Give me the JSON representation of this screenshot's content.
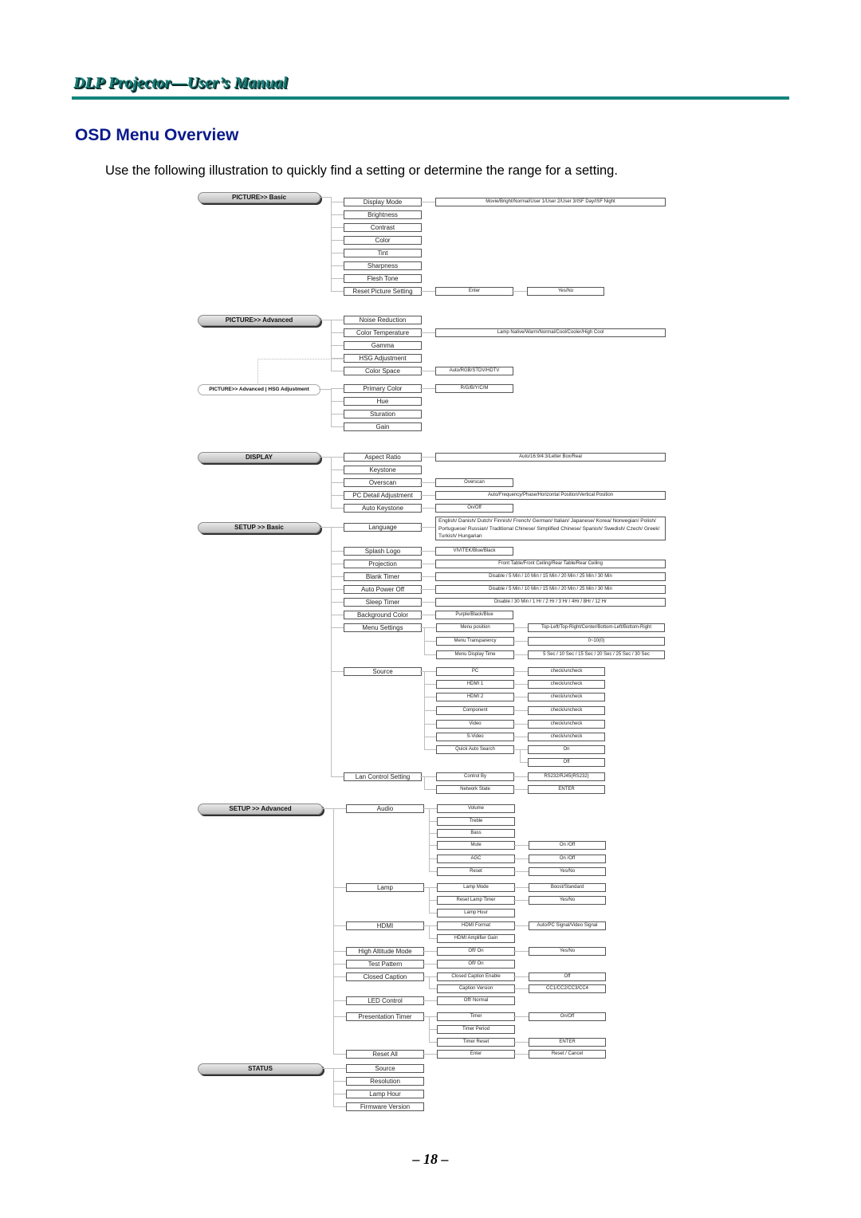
{
  "header": {
    "title": "DLP Projector—User’s Manual"
  },
  "page_title": "OSD Menu Overview",
  "intro": "Use the following illustration to quickly find a setting or determine the range for a setting.",
  "page_number": "– 18 –",
  "sections": [
    {
      "label": "PICTURE>> Basic",
      "items": [
        {
          "label": "Display Mode",
          "options": [
            "Movie/Bright/Normal/User 1/User 2/User 3/ISF Day/ISF Night"
          ]
        },
        {
          "label": "Brightness"
        },
        {
          "label": "Contrast"
        },
        {
          "label": "Color"
        },
        {
          "label": "Tint"
        },
        {
          "label": "Sharpness"
        },
        {
          "label": "Flesh Tone"
        },
        {
          "label": "Reset Picture Setting",
          "options": [
            "Enter",
            "Yes/No"
          ]
        }
      ]
    },
    {
      "label": "PICTURE>> Advanced",
      "items": [
        {
          "label": "Noise Reduction"
        },
        {
          "label": "Color Temperature",
          "options": [
            "Lamp Native/Warm/Normal/Cool/Cooler/High Cool"
          ]
        },
        {
          "label": "Gamma"
        },
        {
          "label": "HSG Adjustment"
        },
        {
          "label": "Color Space",
          "options": [
            "Auto/RGB/STDV/HDTV"
          ]
        }
      ]
    },
    {
      "label": "PICTURE>> Advanced | HSG Adjustment",
      "items": [
        {
          "label": "Primary Color",
          "options": [
            "R/G/B/Y/C/M"
          ]
        },
        {
          "label": "Hue"
        },
        {
          "label": "Sturation"
        },
        {
          "label": "Gain"
        }
      ]
    },
    {
      "label": "DISPLAY",
      "items": [
        {
          "label": "Aspect Ratio",
          "options": [
            "Auto/16:9/4:3/Letter Box/Real"
          ]
        },
        {
          "label": "Keystone"
        },
        {
          "label": "Overscan",
          "options": [
            "Overscan"
          ]
        },
        {
          "label": "PC Detail Adjustment",
          "options": [
            "Auto/Frequency/Phase/Horizontal Position/Vertical Position"
          ]
        },
        {
          "label": "Auto Keystone",
          "options": [
            "On/Off"
          ]
        }
      ]
    },
    {
      "label": "SETUP >> Basic",
      "items": [
        {
          "label": "Language",
          "options": [
            "English/ Danish/ Dutch/ Finnish/ French/ German/ Italian/ Japanese/ Korea/ Norwegian/ Polish/ Portuguese/ Russian/ Traditional Chinese/ Simplified Chinese/ Spanish/ Swedish/ Czech/ Greek/ Turkish/ Hungarian"
          ]
        },
        {
          "label": "Splash Logo",
          "options": [
            "VIVITEK/Blue/Black"
          ]
        },
        {
          "label": "Projection",
          "options": [
            "Front Table/Front Ceiling/Rear Table/Rear Ceiling"
          ]
        },
        {
          "label": "Blank Timer",
          "options": [
            "Disable / 5 Min / 10 Min / 15 Min / 20 Min / 25 Min / 30 Min"
          ]
        },
        {
          "label": "Auto Power Off",
          "options": [
            "Disable / 5 Min / 10 Min / 15 Min / 20 Min / 25 Min / 30 Min"
          ]
        },
        {
          "label": "Sleep Timer",
          "options": [
            "Disable / 30 Min / 1 Hr / 2 Hr / 3 Hr / 4Hr / 8Hr / 12 Hr"
          ]
        },
        {
          "label": "Background Color",
          "options": [
            "Purple/Black/Blue"
          ]
        },
        {
          "label": "Menu Settings",
          "children": [
            {
              "label": "Menu position",
              "value": "Top-Left/Top-Right/Center/Bottom-Left/Bottom-Right"
            },
            {
              "label": "Menu Transparency",
              "value": "0~10(0)"
            },
            {
              "label": "Menu Display Time",
              "value": "5 Sec / 10 Sec / 15 Sec / 20 Sec / 25 Sec / 30 Sec"
            }
          ]
        },
        {
          "label": "Source",
          "children": [
            {
              "label": "PC",
              "value": "check/uncheck"
            },
            {
              "label": "HDMI 1",
              "value": "check/uncheck"
            },
            {
              "label": "HDMI 2",
              "value": "check/uncheck"
            },
            {
              "label": "Component",
              "value": "check/uncheck"
            },
            {
              "label": "Video",
              "value": "check/uncheck"
            },
            {
              "label": "S-Video",
              "value": "check/uncheck"
            },
            {
              "label": "Quick Auto Search",
              "values": [
                "On",
                "Off"
              ]
            }
          ]
        },
        {
          "label": "Lan Control Setting",
          "children": [
            {
              "label": "Control By",
              "value": "RS232/RJ45(RS232)"
            },
            {
              "label": "Network State",
              "value": "ENTER"
            }
          ]
        }
      ]
    },
    {
      "label": "SETUP >> Advanced",
      "items": [
        {
          "label": "Audio",
          "children": [
            {
              "label": "Volume"
            },
            {
              "label": "Treble"
            },
            {
              "label": "Bass"
            },
            {
              "label": "Mute",
              "value": "On /Off"
            },
            {
              "label": "AGC",
              "value": "On /Off"
            },
            {
              "label": "Reset",
              "value": "Yes/No"
            }
          ]
        },
        {
          "label": "Lamp",
          "children": [
            {
              "label": "Lamp Mode",
              "value": "Boost/Standard"
            },
            {
              "label": "Reset Lamp Timer",
              "value": "Yes/No"
            },
            {
              "label": "Lamp Hour"
            }
          ]
        },
        {
          "label": "HDMI",
          "children": [
            {
              "label": "HDMI Format",
              "value": "Auto/PC Signal/Video Signal"
            },
            {
              "label": "HDMI Amplifier Gain"
            }
          ]
        },
        {
          "label": "High Altitude Mode",
          "children": [
            {
              "label": "Off/ On",
              "value": "Yes/No"
            }
          ]
        },
        {
          "label": "Test Pattern",
          "children": [
            {
              "label": "Off/ On"
            }
          ]
        },
        {
          "label": "Closed Caption",
          "children": [
            {
              "label": "Closed Caption Enable",
              "value": "Off"
            },
            {
              "label": "Caption Version",
              "value": "CC1/CC2/CC3/CC4"
            }
          ]
        },
        {
          "label": "LED Control",
          "children": [
            {
              "label": "Off/ Normal"
            }
          ]
        },
        {
          "label": "Presentation Timer",
          "children": [
            {
              "label": "Timer",
              "value": "On/Off"
            },
            {
              "label": "Timer Period"
            },
            {
              "label": "Timer Reset",
              "value": "ENTER"
            }
          ]
        },
        {
          "label": "Reset All",
          "children": [
            {
              "label": "Enter",
              "value": "Reset / Cancel"
            }
          ]
        }
      ]
    },
    {
      "label": "STATUS",
      "items": [
        {
          "label": "Source"
        },
        {
          "label": "Resolution"
        },
        {
          "label": "Lamp Hour"
        },
        {
          "label": "Firmware Version"
        }
      ]
    }
  ]
}
